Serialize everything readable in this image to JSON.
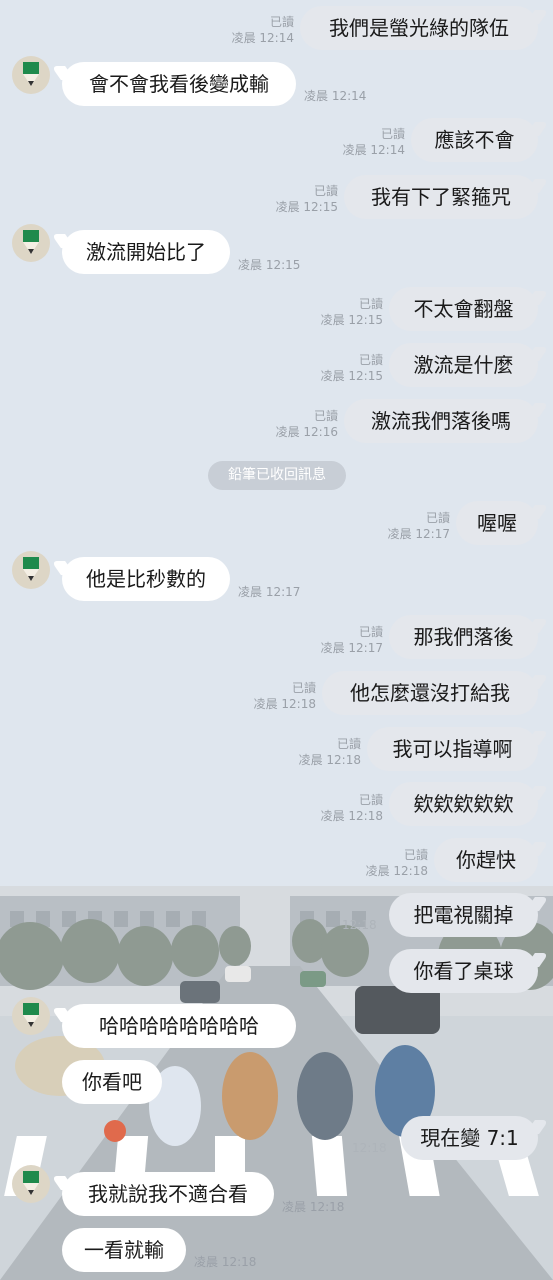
{
  "messages": [
    {
      "text": "我們是螢光綠的隊伍",
      "status": "已讀",
      "time": "凌晨 12:14"
    },
    {
      "text": "會不會我看後變成輸",
      "time": "凌晨 12:14"
    },
    {
      "text": "應該不會",
      "status": "已讀",
      "time": "凌晨 12:14"
    },
    {
      "text": "我有下了緊箍咒",
      "status": "已讀",
      "time": "凌晨 12:15"
    },
    {
      "text": "激流開始比了",
      "time": "凌晨 12:15"
    },
    {
      "text": "不太會翻盤",
      "status": "已讀",
      "time": "凌晨 12:15"
    },
    {
      "text": "激流是什麼",
      "status": "已讀",
      "time": "凌晨 12:15"
    },
    {
      "text": "激流我們落後嗎",
      "status": "已讀",
      "time": "凌晨 12:16"
    },
    {
      "text": "喔喔",
      "status": "已讀",
      "time": "凌晨 12:17"
    },
    {
      "text": "他是比秒數的",
      "time": "凌晨 12:17"
    },
    {
      "text": "那我們落後",
      "status": "已讀",
      "time": "凌晨 12:17"
    },
    {
      "text": "他怎麼還沒打給我",
      "status": "已讀",
      "time": "凌晨 12:18"
    },
    {
      "text": "我可以指導啊",
      "status": "已讀",
      "time": "凌晨 12:18"
    },
    {
      "text": "欸欸欸欸欸",
      "status": "已讀",
      "time": "凌晨 12:18"
    },
    {
      "text": "你趕快",
      "status": "已讀",
      "time": "凌晨 12:18"
    },
    {
      "text": "把電視關掉",
      "time": "12:18"
    },
    {
      "text": "你看了桌球"
    },
    {
      "text": "哈哈哈哈哈哈哈哈"
    },
    {
      "text": "你看吧"
    },
    {
      "text": "現在變 7:1",
      "time": "12:18"
    },
    {
      "text": "我就說我不適合看",
      "time": "凌晨 12:18"
    },
    {
      "text": "一看就輸",
      "time": "凌晨 12:18"
    }
  ],
  "system_notice": "鉛筆已收回訊息",
  "colors": {
    "background": "#dfe6ee",
    "outgoing_bubble": "#e4e7ec",
    "incoming_bubble": "#ffffff",
    "avatar_green": "#1f8a4c"
  }
}
